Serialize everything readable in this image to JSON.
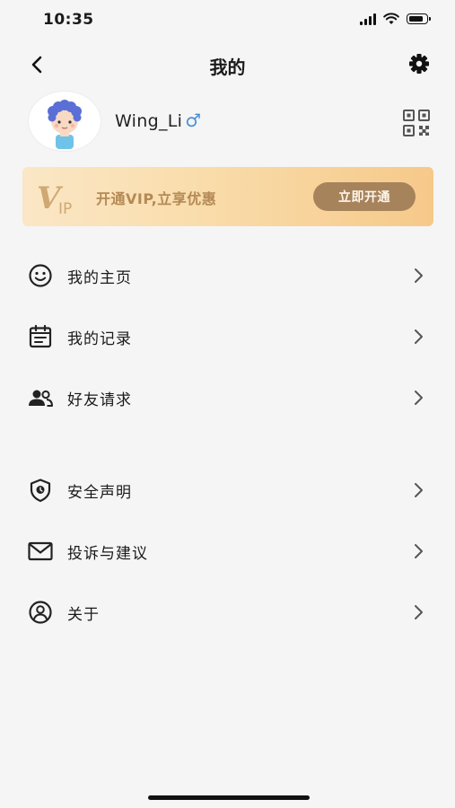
{
  "status": {
    "time": "10:35"
  },
  "header": {
    "title": "我的"
  },
  "profile": {
    "username": "Wing_Li",
    "gender_symbol": "♂"
  },
  "vip": {
    "logo_text": "VIP",
    "text": "开通VIP,立享优惠",
    "button_label": "立即开通"
  },
  "menu": {
    "items": [
      {
        "label": "我的主页",
        "icon": "smile-icon"
      },
      {
        "label": "我的记录",
        "icon": "calendar-icon"
      },
      {
        "label": "好友请求",
        "icon": "friends-icon"
      },
      {
        "label": "安全声明",
        "icon": "shield-icon"
      },
      {
        "label": "投诉与建议",
        "icon": "mail-icon"
      },
      {
        "label": "关于",
        "icon": "user-circle-icon"
      }
    ]
  },
  "colors": {
    "vip_button": "#a7835c",
    "vip_text": "#b48a55",
    "gender": "#4a8fd6"
  }
}
